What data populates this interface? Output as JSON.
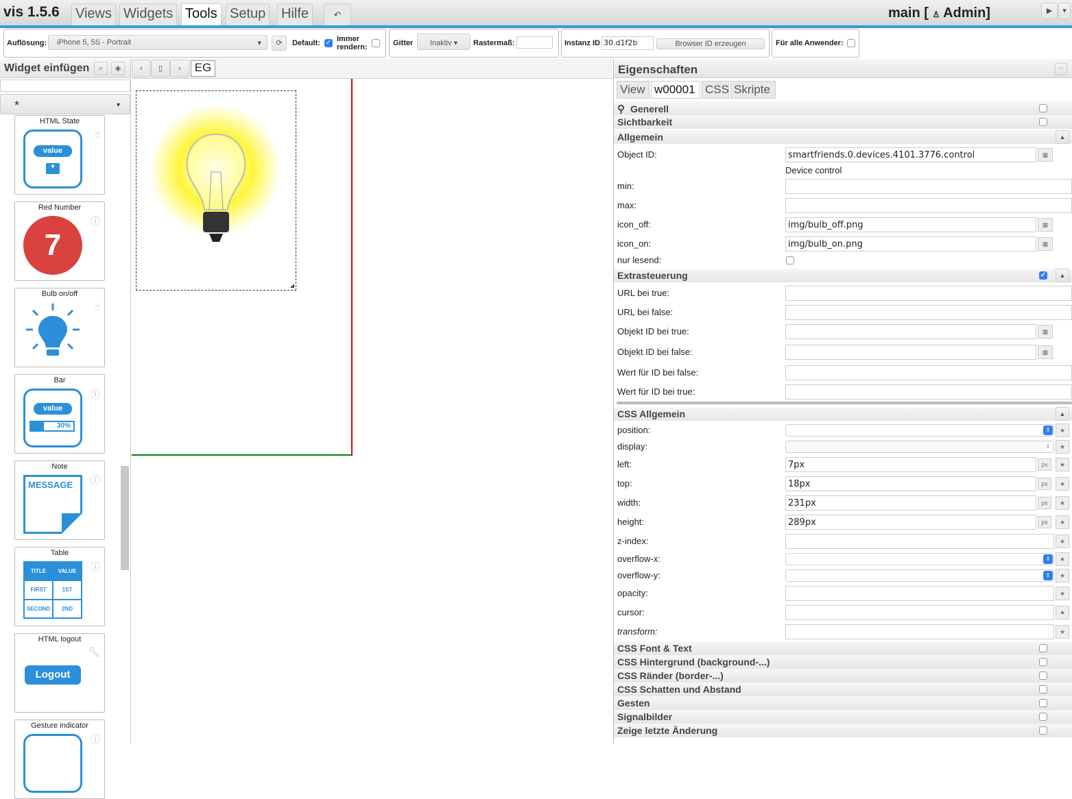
{
  "app": {
    "title": "vis 1.5.6",
    "menu": [
      "Views",
      "Widgets",
      "Tools",
      "Setup",
      "Hilfe"
    ],
    "active_menu": "Tools",
    "undo_icon": "undo-icon",
    "user_prefix": "main [",
    "user_name": "Admin]"
  },
  "toolbar": {
    "resolution_label": "Auflösung:",
    "resolution_value": "iPhone 5, 5S - Portrait",
    "default_label": "Default:",
    "default_checked": true,
    "always_render_label1": "Immer",
    "always_render_label2": "rendern:",
    "grid_label": "Gitter",
    "grid_value": "Inaktiv",
    "raster_label": "Rastermaß:",
    "instance_label": "Instanz ID",
    "instance_value": "30.d1f2b",
    "browser_id_button": "Browser ID erzeugen",
    "all_users_label": "Für alle Anwender:"
  },
  "left": {
    "title": "Widget einfügen",
    "filter_value": "*",
    "widgets": [
      {
        "name": "HTML State",
        "content": "value"
      },
      {
        "name": "Red Number",
        "content": "7"
      },
      {
        "name": "Bulb on/off",
        "content": ""
      },
      {
        "name": "Bar",
        "content": "value",
        "percent": "30%"
      },
      {
        "name": "Note",
        "content": "MESSAGE"
      },
      {
        "name": "Table",
        "cells": [
          "TITLE",
          "VALUE",
          "FIRST",
          "1ST",
          "SECOND",
          "2ND"
        ]
      },
      {
        "name": "HTML logout",
        "content": "Logout"
      },
      {
        "name": "Gesture indicator",
        "content": ""
      }
    ]
  },
  "canvas": {
    "view_name": "EG"
  },
  "props": {
    "title": "Eigenschaften",
    "tabs": [
      "View",
      "w00001",
      "CSS",
      "Skripte"
    ],
    "active_tab": "w00001",
    "groups_top": [
      "Generell",
      "Sichtbarkeit"
    ],
    "allgemein": "Allgemein",
    "object_id_label": "Object ID:",
    "object_id": "smartfriends.0.devices.4101.3776.control",
    "object_desc": "Device control",
    "min_label": "min:",
    "max_label": "max:",
    "icon_off_label": "icon_off:",
    "icon_off": "img/bulb_off.png",
    "icon_on_label": "icon_on:",
    "icon_on": "img/bulb_on.png",
    "readonly_label": "nur lesend:",
    "extra": "Extrasteuerung",
    "url_true": "URL bei true:",
    "url_false": "URL bei false:",
    "oid_true": "Objekt ID bei true:",
    "oid_false": "Objekt ID bei false:",
    "val_false": "Wert für ID bei false:",
    "val_true": "Wert für ID bei true:",
    "css_general": "CSS Allgemein",
    "position": "position:",
    "display": "display:",
    "left": "left:",
    "left_v": "7px",
    "top": "top:",
    "top_v": "18px",
    "width": "width:",
    "width_v": "231px",
    "height": "height:",
    "height_v": "289px",
    "unit": "px",
    "zindex": "z-index:",
    "overflow_x": "overflow-x:",
    "overflow_y": "overflow-y:",
    "opacity": "opacity:",
    "cursor": "cursor:",
    "transform": "transform:",
    "groups_bottom": [
      "CSS Font & Text",
      "CSS Hintergrund (background-...)",
      "CSS Ränder (border-...)",
      "CSS Schatten und Abstand",
      "Gesten",
      "Signalbilder",
      "Zeige letzte Änderung"
    ]
  },
  "colors": {
    "accent": "#3a9ad9",
    "widget_blue": "#2b8fd9",
    "red": "#d9423f"
  }
}
